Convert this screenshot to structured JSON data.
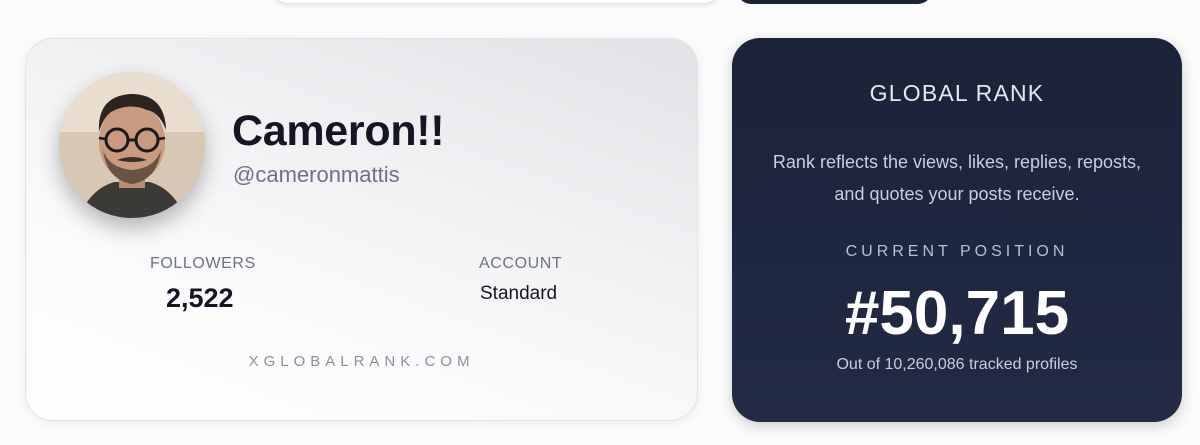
{
  "profile": {
    "display_name": "Cameron!!",
    "handle": "@cameronmattis",
    "avatar_icon": "user-photo",
    "stats": {
      "followers_label": "FOLLOWERS",
      "followers_value": "2,522",
      "account_label": "ACCOUNT",
      "account_value": "Standard"
    },
    "footer": "XGLOBALRANK.COM"
  },
  "rank": {
    "title": "GLOBAL RANK",
    "description": "Rank reflects the views, likes, replies, reposts, and quotes your posts receive.",
    "position_label": "CURRENT POSITION",
    "position_value": "#50,715",
    "total_text": "Out of 10,260,086 tracked profiles"
  },
  "colors": {
    "rank_card_bg": "#1b2338",
    "text_dark": "#141624",
    "muted": "#6b7388"
  }
}
